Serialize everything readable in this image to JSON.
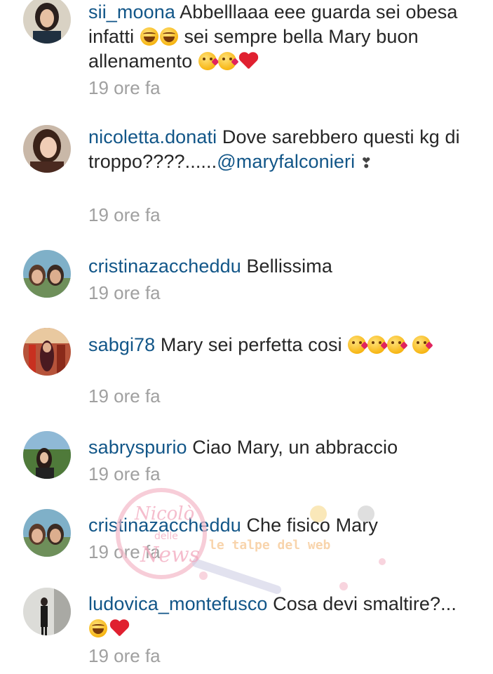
{
  "comments": [
    {
      "username": "sii_moona",
      "parts": [
        "Abbelllaaa eee guarda sei obesa infatti",
        "sei sempre bella Mary buon allenamento"
      ],
      "time": "19 ore fa"
    },
    {
      "username": "nicoletta.donati",
      "parts": [
        "Dove sarebbero questi kg di troppo????......",
        "@maryfalconieri"
      ],
      "time": "19 ore fa"
    },
    {
      "username": "cristinazaccheddu",
      "parts": [
        "Bellissima"
      ],
      "time": "19 ore fa"
    },
    {
      "username": "sabgi78",
      "parts": [
        "Mary sei perfetta cosi"
      ],
      "time": "19 ore fa"
    },
    {
      "username": "sabryspurio",
      "parts": [
        "Ciao Mary, un abbraccio"
      ],
      "time": "19 ore fa"
    },
    {
      "username": "cristinazaccheddu",
      "parts": [
        "Che fisico Mary"
      ],
      "time": "19 ore fa"
    },
    {
      "username": "ludovica_montefusco",
      "parts": [
        "Cosa devi smaltire?..."
      ],
      "time": "19 ore fa"
    }
  ],
  "icons": {
    "laugh": "face-with-tears-of-joy-icon",
    "kiss": "face-blowing-kiss-icon",
    "heart": "red-heart-icon",
    "bow": "ribbon-icon"
  },
  "colors": {
    "username": "#125688",
    "text": "#262626",
    "time": "#a0a0a0"
  },
  "watermark": {
    "line1": "Nicolò",
    "line2": "delle",
    "line3": "News",
    "tagline": "le talpe del web"
  }
}
